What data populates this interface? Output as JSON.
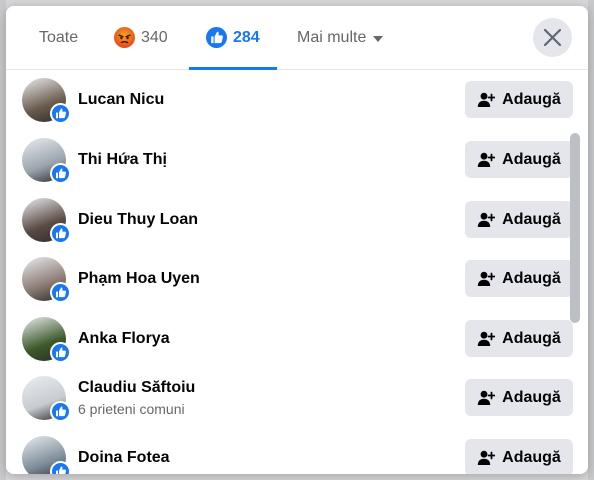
{
  "tabs": {
    "all_label": "Toate",
    "angry_count": "340",
    "like_count": "284",
    "more_label": "Mai multe"
  },
  "icons": {
    "close": "close-icon",
    "add_friend": "add-friend-icon",
    "like_badge": "like-icon",
    "angry": "angry-emoji-icon",
    "caret": "caret-down-icon"
  },
  "colors": {
    "accent": "#1877f2",
    "button_bg": "#e4e6eb",
    "text_primary": "#050505",
    "text_secondary": "#65676b"
  },
  "people": [
    {
      "name": "Lucan Nicu",
      "subtitle": "",
      "action": "Adaugă",
      "avatar_color": "#6b5c4d"
    },
    {
      "name": "Thi Hứa Thị",
      "subtitle": "",
      "action": "Adaugă",
      "avatar_color": "#9aa3ad"
    },
    {
      "name": "Dieu Thuy Loan",
      "subtitle": "",
      "action": "Adaugă",
      "avatar_color": "#5a4a44"
    },
    {
      "name": "Phạm Hoa Uyen",
      "subtitle": "",
      "action": "Adaugă",
      "avatar_color": "#8c7b74"
    },
    {
      "name": "Anka Florya",
      "subtitle": "",
      "action": "Adaugă",
      "avatar_color": "#3d5a2a"
    },
    {
      "name": "Claudiu Săftoiu",
      "subtitle": "6 prieteni comuni",
      "action": "Adaugă",
      "avatar_color": "#c8ccd2"
    },
    {
      "name": "Doina Fotea",
      "subtitle": "",
      "action": "Adaugă",
      "avatar_color": "#7d8c99"
    }
  ]
}
